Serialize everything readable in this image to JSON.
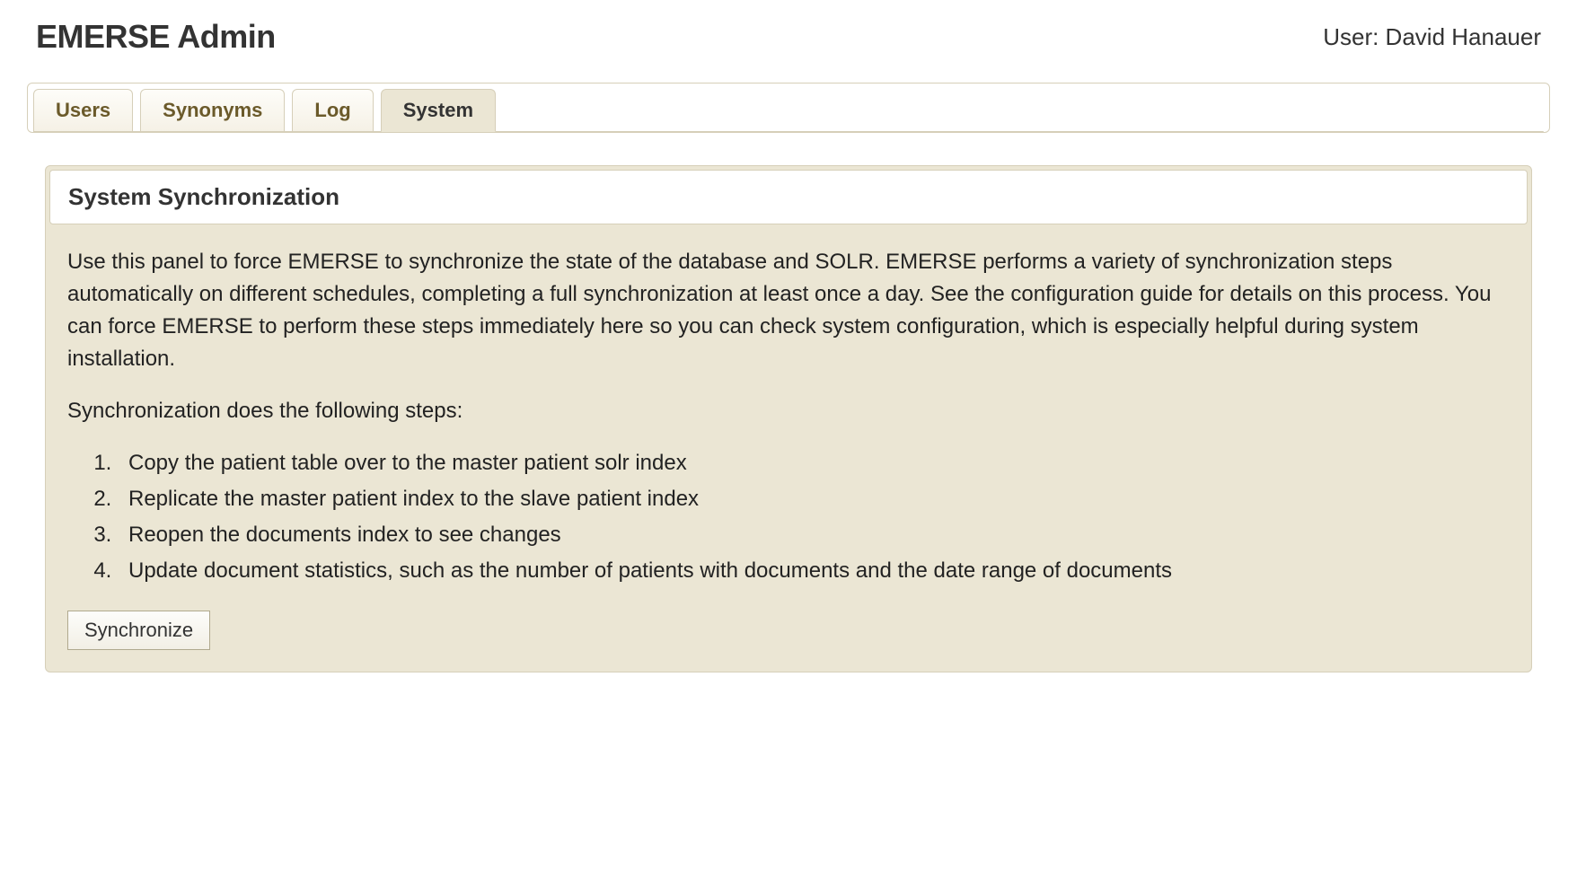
{
  "header": {
    "title": "EMERSE Admin",
    "user_label": "User: David Hanauer"
  },
  "tabs": {
    "users": "Users",
    "synonyms": "Synonyms",
    "log": "Log",
    "system": "System"
  },
  "panel": {
    "title": "System Synchronization",
    "description": "Use this panel to force EMERSE to synchronize the state of the database and SOLR. EMERSE performs a variety of synchronization steps automatically on different schedules, completing a full synchronization at least once a day. See the configuration guide for details on this process. You can force EMERSE to perform these steps immediately here so you can check system configuration, which is especially helpful during system installation.",
    "steps_intro": "Synchronization does the following steps:",
    "steps": [
      "Copy the patient table over to the master patient solr index",
      "Replicate the master patient index to the slave patient index",
      "Reopen the documents index to see changes",
      "Update document statistics, such as the number of patients with documents and the date range of documents"
    ],
    "button_label": "Synchronize"
  }
}
